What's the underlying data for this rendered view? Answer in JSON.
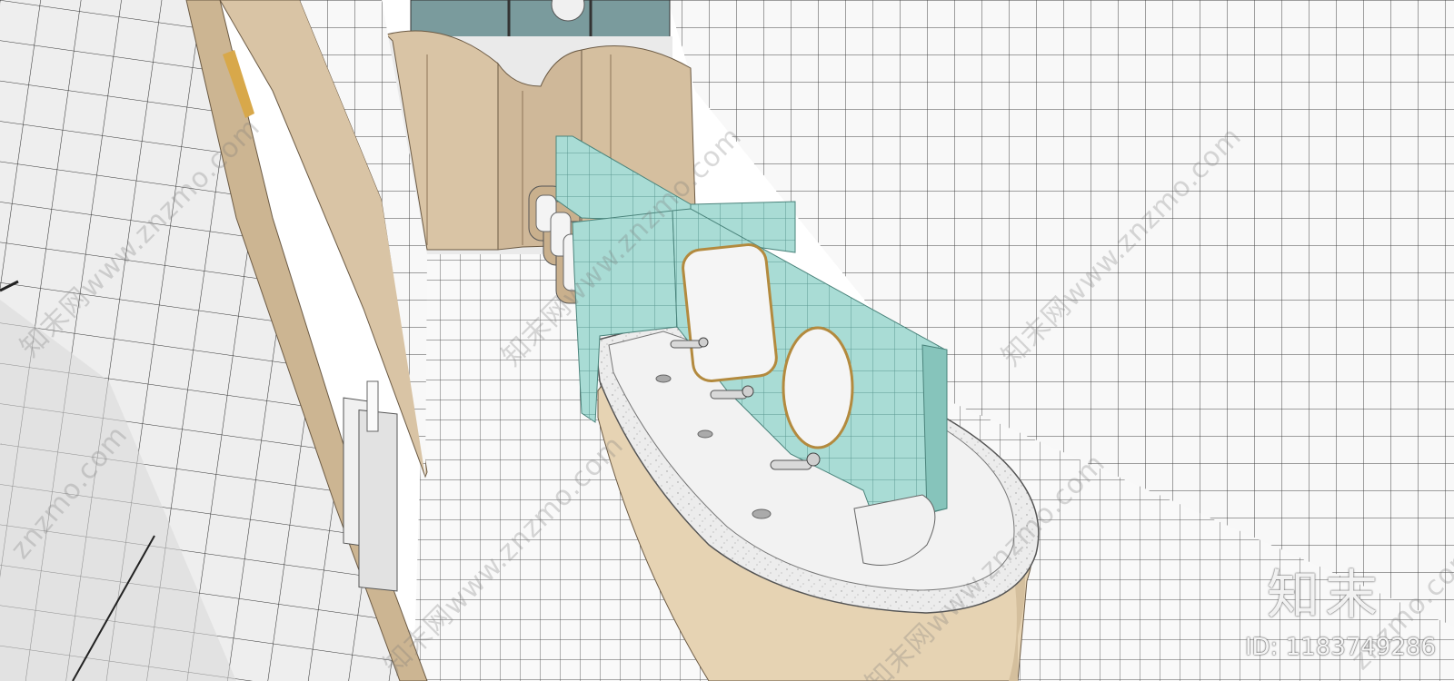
{
  "watermark": {
    "site_text": "知末网www.znzmo.com",
    "site_text_short": "znzmo.com",
    "brand": "知末",
    "id_label": "ID: 1183749286"
  },
  "colors": {
    "tile_white": "#f7f7f7",
    "grout": "#555555",
    "wood": "#d9c4a5",
    "wood_dark": "#b79f7f",
    "mint_tile": "#a9dcd5",
    "mint_dark": "#7fbdb4",
    "terrazzo": "#ececec",
    "window_teal": "#7a9b9d"
  }
}
